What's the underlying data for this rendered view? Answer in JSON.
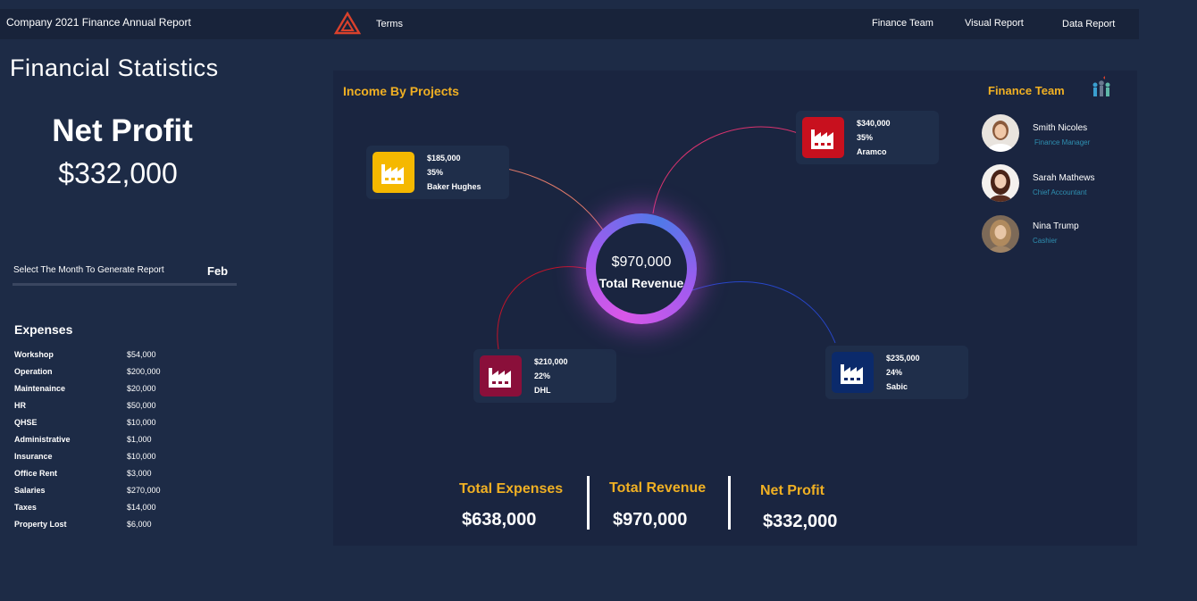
{
  "header": {
    "title": "Company 2021 Finance Annual Report",
    "terms": "Terms",
    "nav": [
      "Finance Team",
      "Visual Report",
      "Data Report"
    ]
  },
  "stats": {
    "title": "Financial Statistics",
    "net_profit_label": "Net Profit",
    "net_profit_value": "$332,000",
    "month_label": "Select The Month To Generate Report",
    "month_value": "Feb"
  },
  "expenses": {
    "title": "Expenses",
    "items": [
      {
        "name": "Workshop",
        "value": "$54,000"
      },
      {
        "name": "Operation",
        "value": "$200,000"
      },
      {
        "name": "Maintenaince",
        "value": "$20,000"
      },
      {
        "name": "HR",
        "value": "$50,000"
      },
      {
        "name": "QHSE",
        "value": "$10,000"
      },
      {
        "name": "Administrative",
        "value": "$1,000"
      },
      {
        "name": "Insurance",
        "value": "$10,000"
      },
      {
        "name": "Office Rent",
        "value": "$3,000"
      },
      {
        "name": "Salaries",
        "value": "$270,000"
      },
      {
        "name": "Taxes",
        "value": "$14,000"
      },
      {
        "name": "Property Lost",
        "value": "$6,000"
      }
    ]
  },
  "projects": {
    "title": "Income By Projects",
    "total_value": "$970,000",
    "total_label": "Total Revenue",
    "items": [
      {
        "amount": "$185,000",
        "percent": "35%",
        "name": "Baker Hughes",
        "color": "#f5b800"
      },
      {
        "amount": "$340,000",
        "percent": "35%",
        "name": "Aramco",
        "color": "#c8101e"
      },
      {
        "amount": "$210,000",
        "percent": "22%",
        "name": "DHL",
        "color": "#8a0f3a"
      },
      {
        "amount": "$235,000",
        "percent": "24%",
        "name": "Sabic",
        "color": "#0b2a6b"
      }
    ]
  },
  "team": {
    "title": "Finance Team",
    "members": [
      {
        "name": "Smith Nicoles",
        "role": "Finance Manager"
      },
      {
        "name": "Sarah Mathews",
        "role": "Chief Accountant"
      },
      {
        "name": "Nina Trump",
        "role": "Cashier"
      }
    ]
  },
  "summary": {
    "expenses_label": "Total Expenses",
    "expenses_value": "$638,000",
    "revenue_label": "Total Revenue",
    "revenue_value": "$970,000",
    "profit_label": "Net Profit",
    "profit_value": "$332,000"
  },
  "colors": {
    "accent": "#f0b023",
    "background": "#1d2b46",
    "panel": "#1a2540",
    "role_text": "#2e8fb0"
  }
}
